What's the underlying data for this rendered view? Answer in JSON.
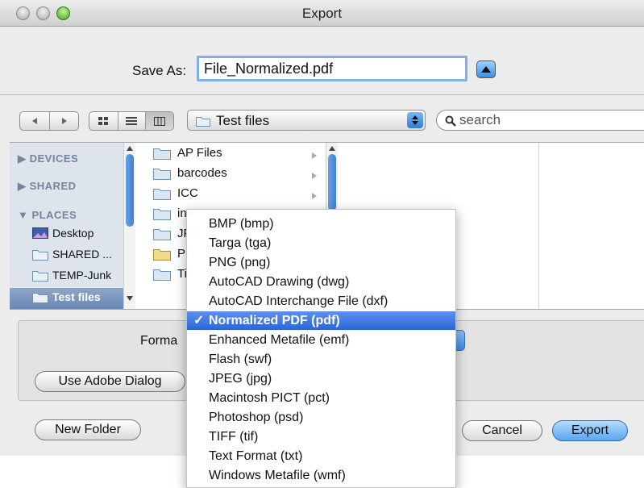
{
  "window": {
    "title": "Export"
  },
  "save_as": {
    "label": "Save As:",
    "value": "File_Normalized.pdf"
  },
  "location": {
    "folder": "Test files"
  },
  "search": {
    "placeholder": "search"
  },
  "view_modes": [
    "icon",
    "list",
    "column"
  ],
  "sidebar": {
    "devices": "DEVICES",
    "shared": "SHARED",
    "places": "PLACES",
    "items": [
      "Desktop",
      "SHARED ...",
      "TEMP-Junk",
      "Test files"
    ]
  },
  "files": [
    "AP Files",
    "barcodes",
    "ICC",
    "inP",
    "JPC",
    "PD",
    "Tif"
  ],
  "format": {
    "label": "Forma"
  },
  "buttons": {
    "use_adobe": "Use Adobe Dialog",
    "new_folder": "New Folder",
    "cancel": "Cancel",
    "export": "Export"
  },
  "format_menu": {
    "items": [
      "BMP (bmp)",
      "Targa (tga)",
      "PNG (png)",
      "AutoCAD Drawing (dwg)",
      "AutoCAD Interchange File (dxf)",
      "Normalized PDF (pdf)",
      "Enhanced Metafile (emf)",
      "Flash (swf)",
      "JPEG (jpg)",
      "Macintosh PICT (pct)",
      "Photoshop (psd)",
      "TIFF (tif)",
      "Text Format (txt)",
      "Windows Metafile (wmf)"
    ],
    "selected": "Normalized PDF (pdf)",
    "check_mark": "✓"
  },
  "colors": {
    "accent": "#2a66d9",
    "sidebar_bg": "#dde4ec",
    "zoom_button": "#3fa320"
  }
}
